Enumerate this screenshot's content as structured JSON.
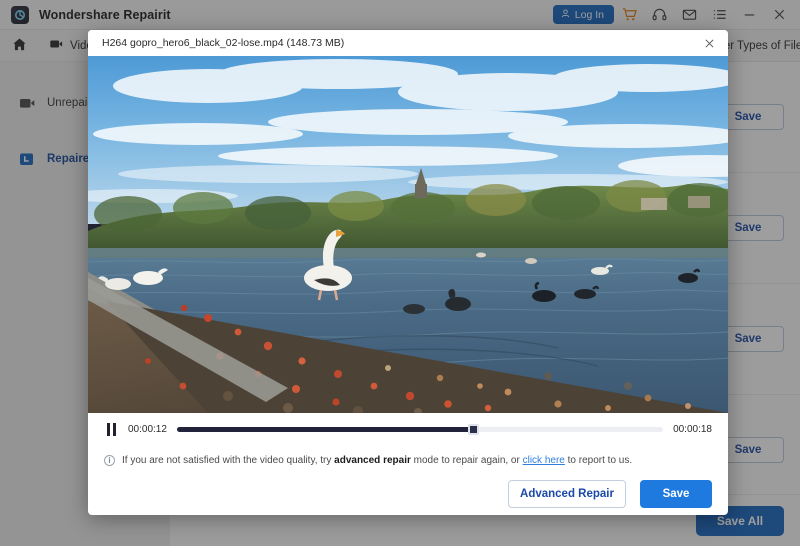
{
  "window": {
    "title": "Wondershare Repairit",
    "logo_icon": "repairit-logo-icon"
  },
  "titlebar": {
    "login_label": "Log In",
    "login_icon": "user-icon",
    "cart_icon": "cart-icon",
    "support_icon": "headset-icon",
    "mail_icon": "mail-icon",
    "menu_icon": "list-menu-icon",
    "minimize_icon": "minimize-icon",
    "close_icon": "close-icon",
    "accent": "#1565c0"
  },
  "navbar": {
    "home_icon": "home-icon",
    "items": [
      {
        "label": "Video Repair",
        "icon": "video-icon"
      },
      {
        "label": "Other Types of Files",
        "icon": "files-icon"
      }
    ]
  },
  "sidebar": {
    "items": [
      {
        "label": "Unrepaired",
        "icon": "video-broken-icon",
        "active": false
      },
      {
        "label": "Repaired",
        "icon": "video-fixed-icon",
        "active": true
      }
    ]
  },
  "list_panel": {
    "row_save_label": "Save",
    "rows": [
      {
        "save_label": "Save"
      },
      {
        "save_label": "Save"
      },
      {
        "save_label": "Save"
      },
      {
        "save_label": "Save"
      }
    ],
    "save_all_label": "Save All"
  },
  "dialog": {
    "title": "H264 gopro_hero6_black_02-lose.mp4 (148.73  MB)",
    "close_icon": "close-icon",
    "player": {
      "state_icon": "pause-icon",
      "current_time": "00:00:12",
      "total_time": "00:00:18",
      "progress_percent": 61
    },
    "hint": {
      "icon": "info-icon",
      "text_before": "If you are not satisfied with the video quality, try",
      "emphasis": "advanced repair",
      "text_middle": "mode to repair again, or",
      "link": "click here",
      "text_after": "to report to us."
    },
    "actions": {
      "advanced_repair_label": "Advanced Repair",
      "save_label": "Save"
    }
  }
}
